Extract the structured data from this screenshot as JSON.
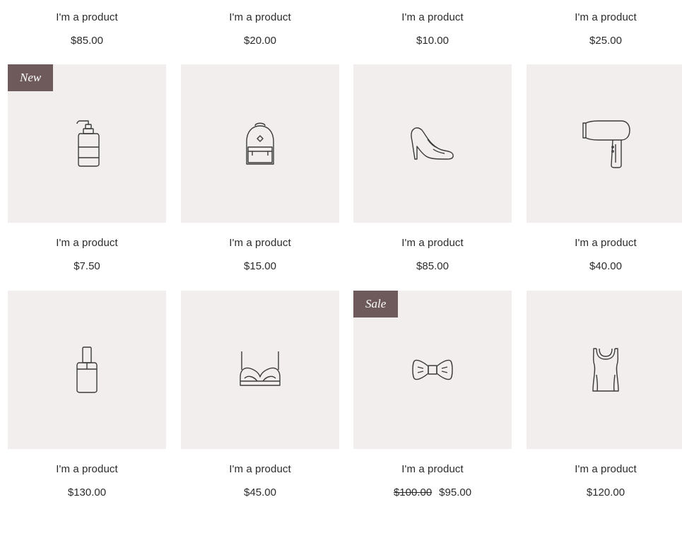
{
  "top_row": [
    {
      "name": "I'm a product",
      "price": "$85.00"
    },
    {
      "name": "I'm a product",
      "price": "$20.00"
    },
    {
      "name": "I'm a product",
      "price": "$10.00"
    },
    {
      "name": "I'm a product",
      "price": "$25.00"
    }
  ],
  "products": [
    {
      "name": "I'm a product",
      "price": "$7.50",
      "ribbon": "New",
      "icon": "soap-pump-bottle-icon"
    },
    {
      "name": "I'm a product",
      "price": "$15.00",
      "ribbon": "",
      "icon": "backpack-icon"
    },
    {
      "name": "I'm a product",
      "price": "$85.00",
      "ribbon": "",
      "icon": "high-heel-shoe-icon"
    },
    {
      "name": "I'm a product",
      "price": "$40.00",
      "ribbon": "",
      "icon": "hair-dryer-icon"
    },
    {
      "name": "I'm a product",
      "price": "$130.00",
      "ribbon": "",
      "icon": "nail-polish-bottle-icon"
    },
    {
      "name": "I'm a product",
      "price": "$45.00",
      "ribbon": "",
      "icon": "bra-icon"
    },
    {
      "name": "I'm a product",
      "price": "$95.00",
      "original_price": "$100.00",
      "ribbon": "Sale",
      "icon": "bow-tie-icon"
    },
    {
      "name": "I'm a product",
      "price": "$120.00",
      "ribbon": "",
      "icon": "tank-top-icon"
    }
  ],
  "colors": {
    "card_background": "#f2eeed",
    "ribbon_background": "#6e5a5a",
    "text": "#2b2b2b",
    "icon_stroke": "#3a3a3a"
  }
}
